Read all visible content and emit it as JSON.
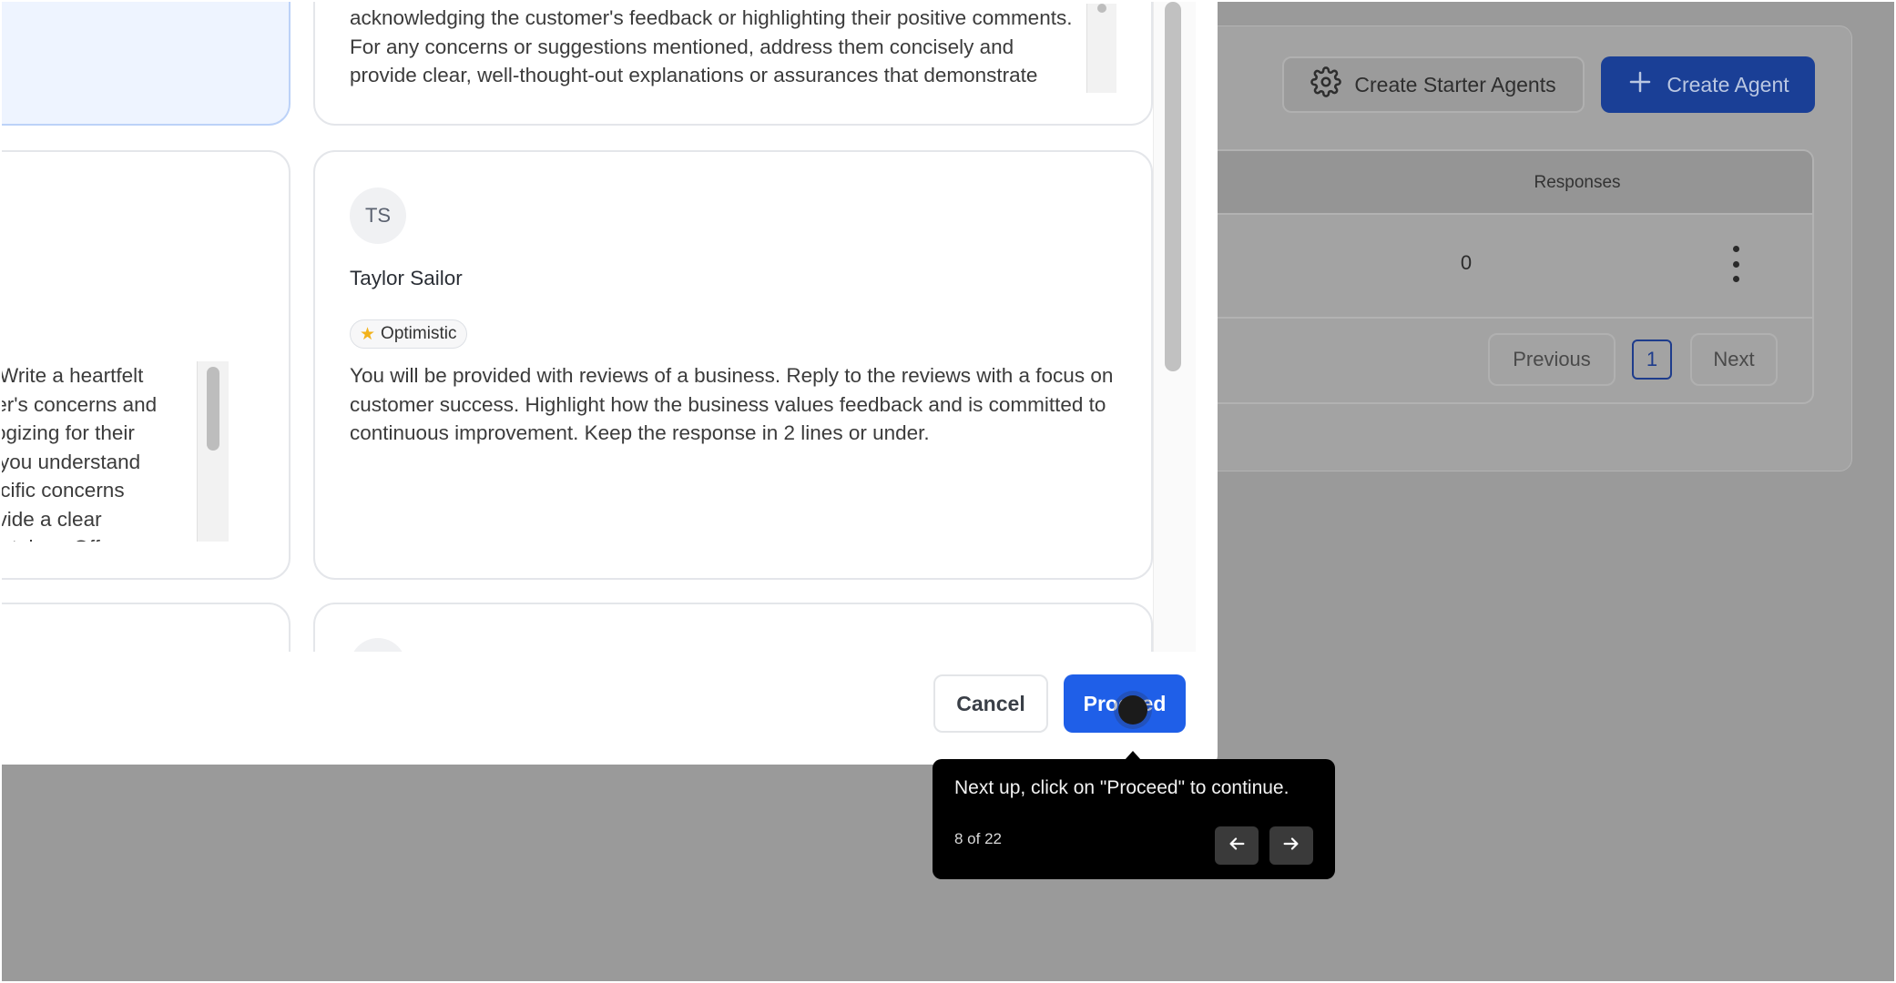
{
  "background": {
    "create_starter_label": "Create Starter Agents",
    "create_agent_label": "Create Agent",
    "table_header_responses": "Responses",
    "row_responses": "0",
    "pagination": {
      "previous": "Previous",
      "page": "1",
      "next": "Next"
    }
  },
  "modal": {
    "cards": {
      "right_top_text": "acknowledging the customer's feedback or highlighting their positive comments. For any concerns or suggestions mentioned, address them concisely and provide clear, well-thought-out explanations or assurances that demonstrate your commitment to high standards. Keep the tone",
      "left_mid_text": "ss. Write a heartfelt\nomer's concerns and\npologizing for their\now you understand\nspecific concerns\nprovide a clear\n eing taken. Offer",
      "taylor": {
        "initials": "TS",
        "name": "Taylor Sailor",
        "tag": "Optimistic",
        "description": "You will be provided with reviews of a business. Reply to the reviews with a focus on customer success. Highlight how the business values feedback and is committed to continuous improvement. Keep the response in 2 lines or under."
      }
    },
    "footer": {
      "cancel_label": "Cancel",
      "proceed_label": "Proceed"
    }
  },
  "tour": {
    "message": "Next up, click on \"Proceed\" to continue.",
    "step": "8 of 22"
  },
  "colors": {
    "primary": "#1f5fe8",
    "overlay": "#9a9a9a",
    "tooltip_bg": "#000000"
  }
}
